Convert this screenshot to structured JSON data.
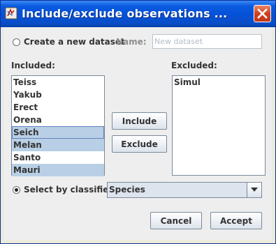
{
  "window": {
    "title": "Include/exclude observations ..."
  },
  "create_dataset": {
    "label": "Create a new dataset",
    "selected": false
  },
  "name_field": {
    "label": "Name:",
    "placeholder": "New dataset",
    "value": ""
  },
  "included": {
    "label": "Included:",
    "items": [
      {
        "label": "Teiss",
        "selected": false
      },
      {
        "label": "Yakub",
        "selected": false
      },
      {
        "label": "Erect",
        "selected": false
      },
      {
        "label": "Orena",
        "selected": false
      },
      {
        "label": "Seich",
        "selected": true
      },
      {
        "label": "Melan",
        "selected": true
      },
      {
        "label": "Santo",
        "selected": false
      },
      {
        "label": "Mauri",
        "selected": true
      }
    ]
  },
  "excluded": {
    "label": "Excluded:",
    "items": [
      {
        "label": "Simul",
        "selected": false
      }
    ]
  },
  "buttons": {
    "include": "Include",
    "exclude": "Exclude",
    "cancel": "Cancel",
    "accept": "Accept"
  },
  "classifier": {
    "label": "Select by classifier",
    "selected": true,
    "value": "Species"
  },
  "icons": {
    "app": "app-icon",
    "close": "close-icon",
    "dropdown": "chevron-down-icon"
  },
  "colors": {
    "title_bar": "#0550d8",
    "close_button": "#d0401f",
    "selection": "#b8cfe5",
    "panel": "#eeeeee"
  }
}
